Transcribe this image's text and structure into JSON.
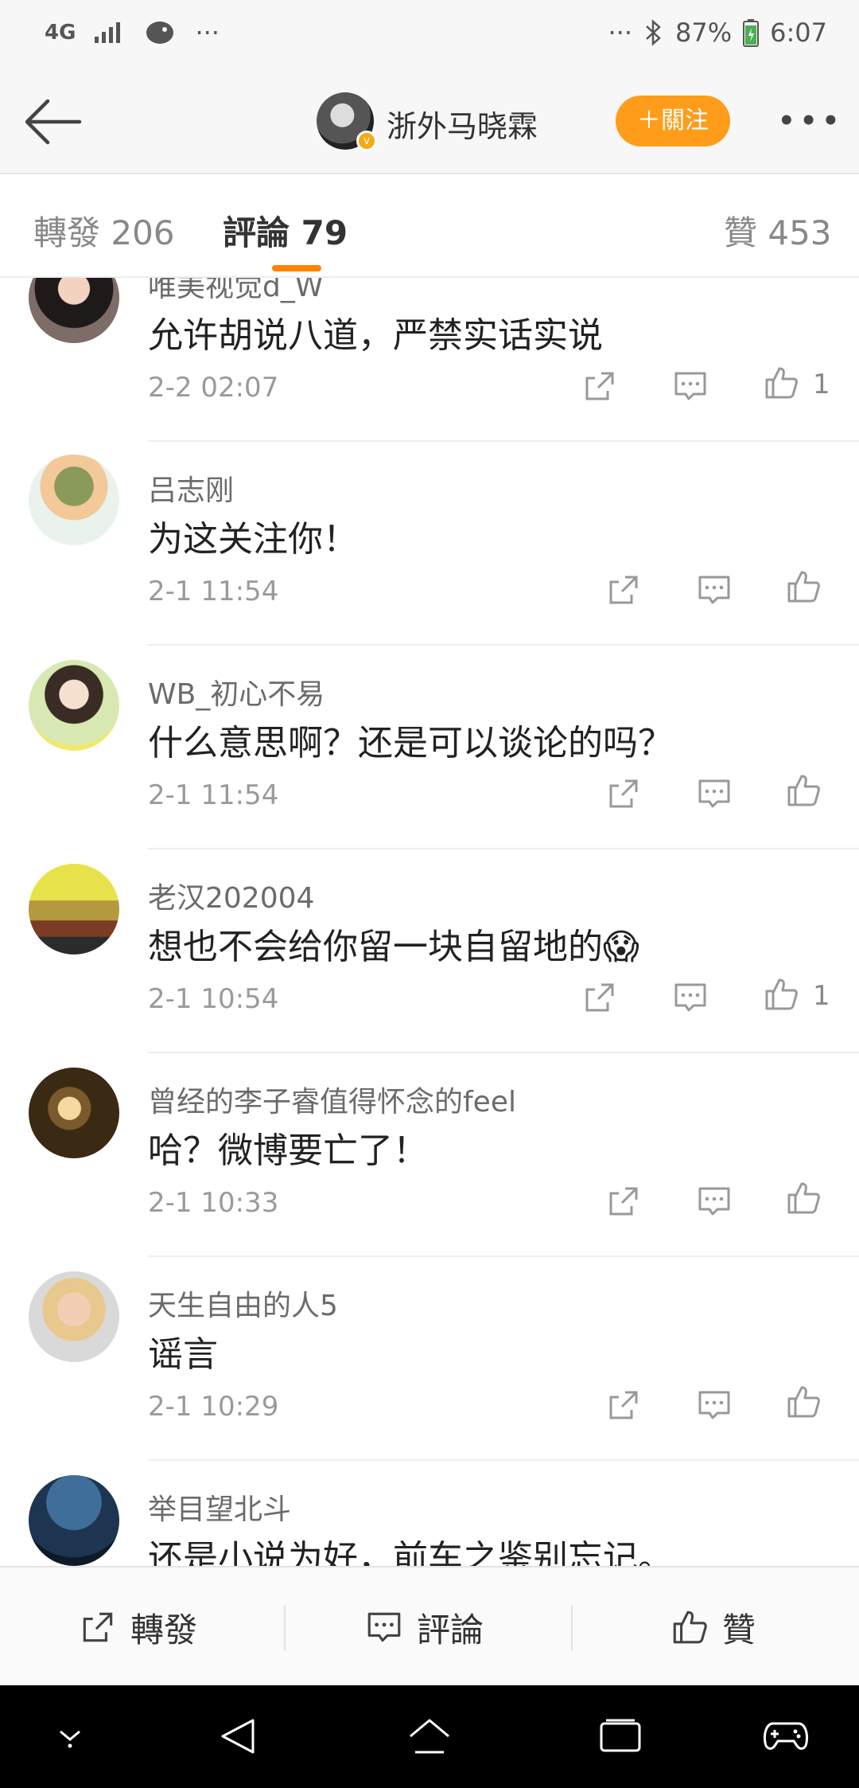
{
  "status_bar": {
    "network": "4G",
    "battery": "87%",
    "time": "6:07",
    "dots": "···"
  },
  "header": {
    "title": "浙外马晓霖",
    "follow_label": "＋關注",
    "verified_badge": "v"
  },
  "tabs": [
    {
      "label": "轉發 206",
      "active": false
    },
    {
      "label": "評論 79",
      "active": true
    },
    {
      "label": "贊 453",
      "active": false
    }
  ],
  "comments": [
    {
      "user": "唯美视觉d_W",
      "text": "允许胡说八道，严禁实话实说",
      "time": "2-2 02:07",
      "likes": "1"
    },
    {
      "user": "吕志刚",
      "text": "为这关注你！",
      "time": "2-1 11:54",
      "likes": ""
    },
    {
      "user": "WB_初心不易",
      "text": "什么意思啊？还是可以谈论的吗？",
      "time": "2-1 11:54",
      "likes": ""
    },
    {
      "user": "老汉202004",
      "text": "想也不会给你留一块自留地的😱",
      "time": "2-1 10:54",
      "likes": "1"
    },
    {
      "user": "曾经的李子睿值得怀念的feel",
      "text": "哈？微博要亡了！",
      "time": "2-1 10:33",
      "likes": ""
    },
    {
      "user": "天生自由的人5",
      "text": "谣言",
      "time": "2-1 10:29",
      "likes": ""
    },
    {
      "user": "举目望北斗",
      "text": "还是小说为好，前车之鉴别忘记。",
      "time": "",
      "likes": ""
    }
  ],
  "bottom_bar": {
    "repost": "轉發",
    "comment": "評論",
    "like": "贊"
  },
  "colors": {
    "accent": "#ff8200",
    "follow_button": "#ff9c19"
  }
}
